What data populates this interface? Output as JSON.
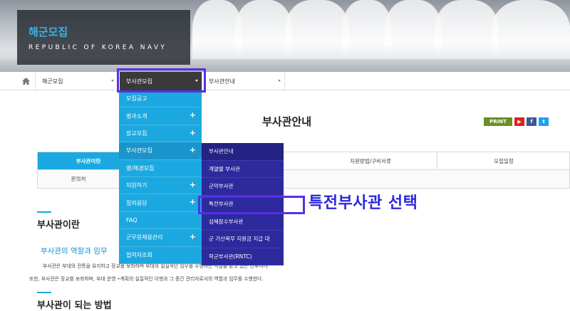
{
  "header": {
    "title": "해군모집",
    "subtitle": "REPUBLIC OF KOREA NAVY"
  },
  "nav": {
    "home_icon": "home-icon",
    "sel1": "해군모집",
    "sel2": "부사관모집",
    "sel3": "부사관안내"
  },
  "menu1": {
    "items": [
      {
        "label": "모집공고",
        "plus": ""
      },
      {
        "label": "병과소개",
        "plus": "+"
      },
      {
        "label": "장교모집",
        "plus": "+"
      },
      {
        "label": "부사관모집",
        "plus": "+"
      },
      {
        "label": "병/해경모집",
        "plus": ""
      },
      {
        "label": "지원하기",
        "plus": "+"
      },
      {
        "label": "질의응답",
        "plus": "+"
      },
      {
        "label": "FAQ",
        "plus": ""
      },
      {
        "label": "군무원채용관리",
        "plus": "+"
      },
      {
        "label": "협력자조회",
        "plus": ""
      }
    ]
  },
  "menu2": {
    "items": [
      "부사관안내",
      "계열별 부사관",
      "군악부사관",
      "특전부사관",
      "심해잠수부사관",
      "군 가산복무 지원금 지급 대",
      "학군부사관(RNTC)"
    ]
  },
  "page": {
    "title": "부사관안내",
    "share": [
      "PRINT",
      "▶",
      "f",
      "t"
    ]
  },
  "tabs": {
    "row1": [
      "부사관이란",
      "지원방법/구비서류",
      "모집일정"
    ],
    "row2": [
      "문의처"
    ]
  },
  "section1": {
    "title": "부사관이란",
    "sub": "부사관의 역할과 임무",
    "p1": "부사관은 부대의 전통을 유지하고 장교를 보좌하며 부대의 실질적인 임무를 수행하는 역할을 맡고 있는 간부이다.",
    "p2": "또한, 부사관은 장교를 보좌하며, 부대 운영 •계획의 실질적인 이행과 그 중간 관리자로서의 역할과 임무를 수행한다."
  },
  "section2": {
    "title": "부사관이 되는 방법"
  },
  "annotation": "특전부사관 선택",
  "colors": {
    "accent": "#1ba8e0",
    "submenu": "#2c2a9c",
    "highlight": "#5a2ee8"
  }
}
